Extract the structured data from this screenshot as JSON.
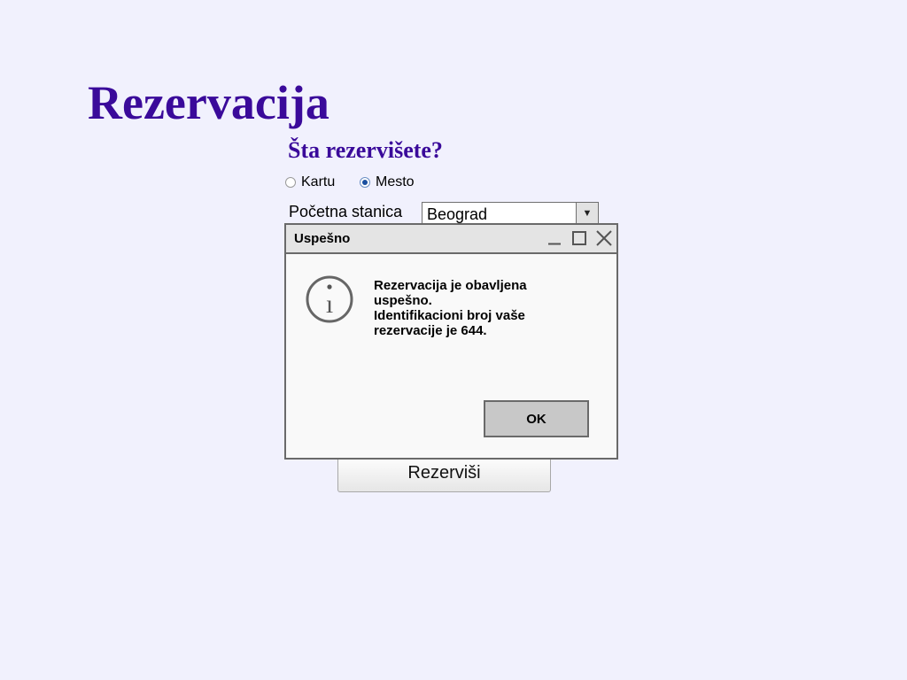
{
  "page": {
    "title": "Rezervacija",
    "question": "Šta rezervišete?"
  },
  "reservation_type": {
    "options": [
      {
        "label": "Kartu",
        "selected": false
      },
      {
        "label": "Mesto",
        "selected": true
      }
    ]
  },
  "station": {
    "label": "Početna stanica",
    "value": "Beograd",
    "arrow_icon": "triangle-down-icon"
  },
  "reserve_button": {
    "label": "Rezerviši"
  },
  "dialog": {
    "title": "Uspešno",
    "icon": "info-icon",
    "message_line_1": "Rezervacija je obavljena uspešno.",
    "message_line_2": "Identifikacioni broj vaše rezervacije je 644.",
    "ok_label": "OK"
  },
  "colors": {
    "background": "#f1f1fd",
    "heading": "#3a0a9a",
    "dialog_border": "#6a6a6a",
    "radio_selected": "#1a4fa0"
  }
}
